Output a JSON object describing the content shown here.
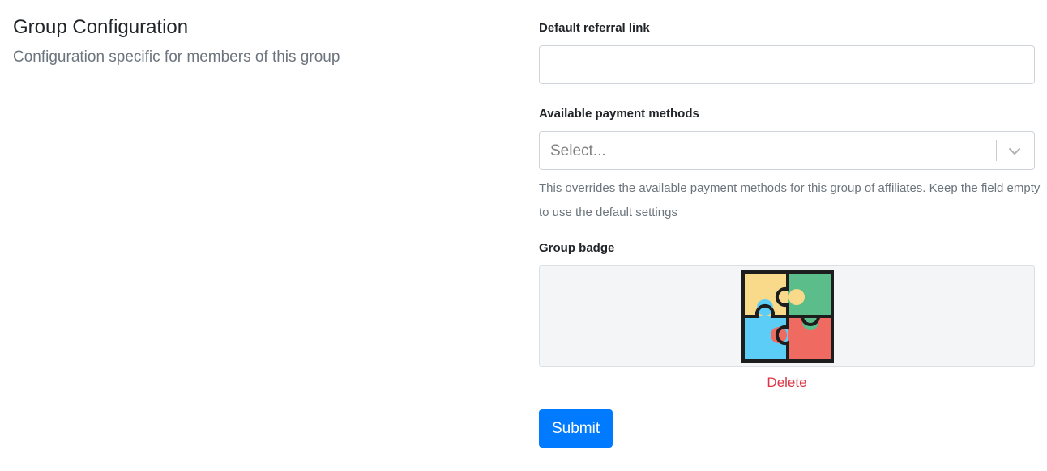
{
  "section": {
    "title": "Group Configuration",
    "description": "Configuration specific for members of this group"
  },
  "referral": {
    "label": "Default referral link",
    "value": "",
    "placeholder": ""
  },
  "payment_methods": {
    "label": "Available payment methods",
    "placeholder": "Select...",
    "dropdown_icon": "chevron-down-icon",
    "help": "This overrides the available payment methods for this group of affiliates. Keep the field empty to use the default settings"
  },
  "badge": {
    "label": "Group badge",
    "image_icon": "puzzle-icon",
    "piece_colors": [
      "#f9d98a",
      "#5bbd8a",
      "#5ccdf7",
      "#ef6b61"
    ],
    "delete_label": "Delete"
  },
  "form": {
    "submit_label": "Submit"
  },
  "colors": {
    "primary": "#007bff",
    "danger": "#dc3545",
    "muted": "#6c757d"
  }
}
